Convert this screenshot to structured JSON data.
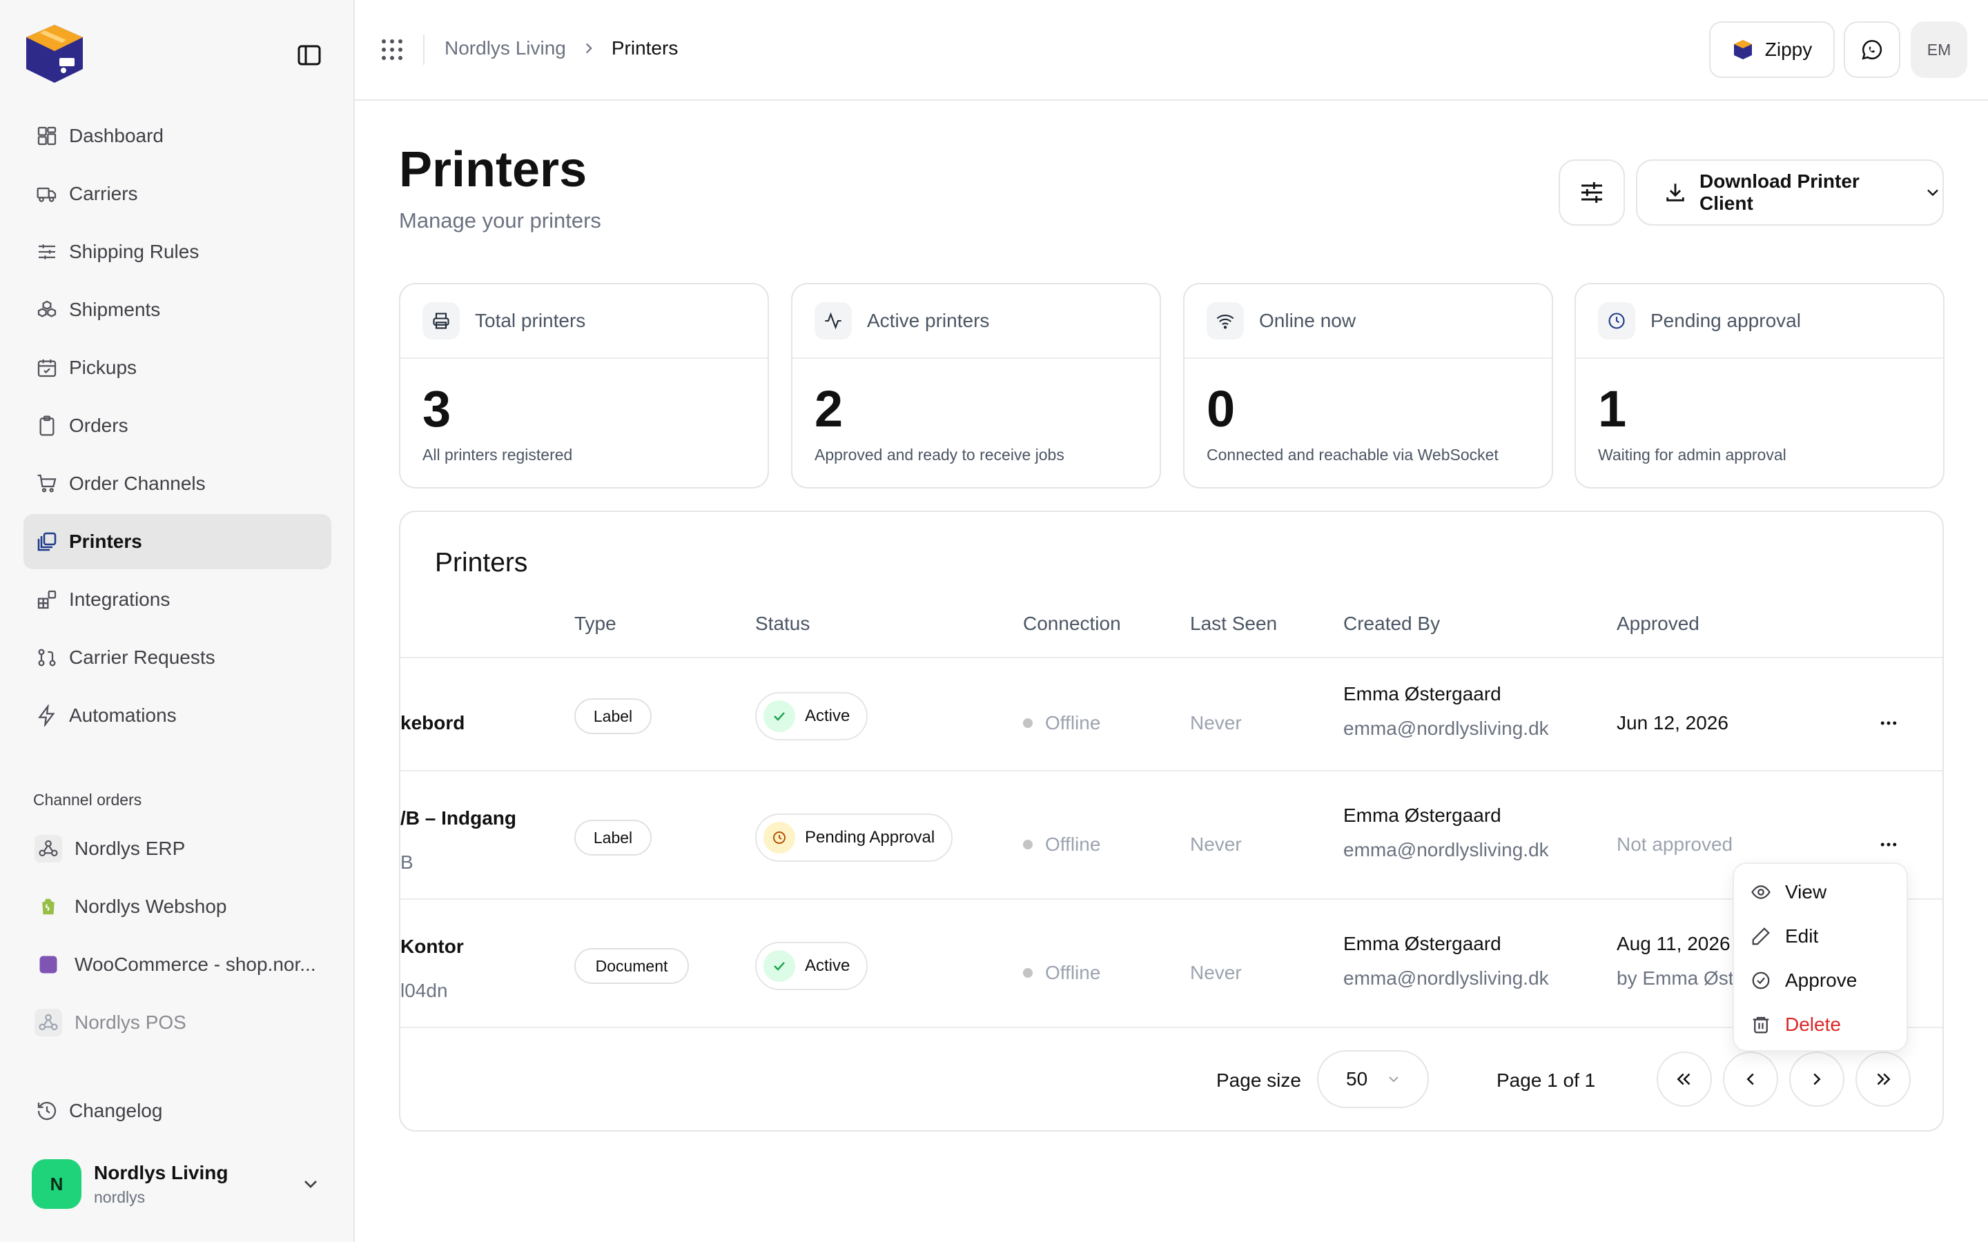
{
  "sidebar": {
    "nav": [
      {
        "label": "Dashboard",
        "icon": "dashboard-icon"
      },
      {
        "label": "Carriers",
        "icon": "truck-icon"
      },
      {
        "label": "Shipping Rules",
        "icon": "sliders-icon"
      },
      {
        "label": "Shipments",
        "icon": "boxes-icon"
      },
      {
        "label": "Pickups",
        "icon": "calendar-check-icon"
      },
      {
        "label": "Orders",
        "icon": "clipboard-icon"
      },
      {
        "label": "Order Channels",
        "icon": "cart-icon"
      },
      {
        "label": "Printers",
        "icon": "printers-icon",
        "active": true
      },
      {
        "label": "Integrations",
        "icon": "blocks-icon"
      },
      {
        "label": "Carrier Requests",
        "icon": "git-pull-request-icon"
      },
      {
        "label": "Automations",
        "icon": "zap-icon"
      }
    ],
    "channels_label": "Channel orders",
    "channels": [
      {
        "label": "Nordlys ERP",
        "icon": "webhook-icon"
      },
      {
        "label": "Nordlys Webshop",
        "icon": "shopify-icon"
      },
      {
        "label": "WooCommerce - shop.nor...",
        "icon": "woocommerce-icon"
      },
      {
        "label": "Nordlys POS",
        "icon": "webhook-icon",
        "muted": true
      }
    ],
    "changelog": "Changelog",
    "user": {
      "initial": "N",
      "name": "Nordlys Living",
      "handle": "nordlys"
    }
  },
  "topbar": {
    "breadcrumb_parent": "Nordlys Living",
    "breadcrumb_current": "Printers",
    "assistant_label": "Zippy",
    "avatar_initials": "EM"
  },
  "header": {
    "title": "Printers",
    "subtitle": "Manage your printers",
    "download_label": "Download Printer Client"
  },
  "stats": [
    {
      "label": "Total printers",
      "value": "3",
      "desc": "All printers registered",
      "icon": "printer-icon"
    },
    {
      "label": "Active printers",
      "value": "2",
      "desc": "Approved and ready to receive jobs",
      "icon": "activity-icon"
    },
    {
      "label": "Online now",
      "value": "0",
      "desc": "Connected and reachable via WebSocket",
      "icon": "wifi-icon"
    },
    {
      "label": "Pending approval",
      "value": "1",
      "desc": "Waiting for admin approval",
      "icon": "clock-icon"
    }
  ],
  "table": {
    "title": "Printers",
    "columns": [
      "Type",
      "Status",
      "Connection",
      "Last Seen",
      "Created By",
      "Approved"
    ],
    "rows": [
      {
        "name": "kebord",
        "sub": "",
        "type": "Label",
        "status": "Active",
        "connection": "Offline",
        "last_seen": "Never",
        "created_name": "Emma Østergaard",
        "created_email": "emma@nordlysliving.dk",
        "approved": "Jun 12, 2026",
        "approved_sub": ""
      },
      {
        "name": "/B – Indgang",
        "sub": "B",
        "type": "Label",
        "status": "Pending Approval",
        "connection": "Offline",
        "last_seen": "Never",
        "created_name": "Emma Østergaard",
        "created_email": "emma@nordlysliving.dk",
        "approved": "Not approved",
        "approved_sub": ""
      },
      {
        "name": "Kontor",
        "sub": "l04dn",
        "type": "Document",
        "status": "Active",
        "connection": "Offline",
        "last_seen": "Never",
        "created_name": "Emma Østergaard",
        "created_email": "emma@nordlysliving.dk",
        "approved": "Aug 11, 2026",
        "approved_sub": "by Emma Øst"
      }
    ],
    "page_size_label": "Page size",
    "page_size_value": "50",
    "page_info": "Page 1 of 1"
  },
  "menu": {
    "items": [
      "View",
      "Edit",
      "Approve",
      "Delete"
    ]
  },
  "colors": {
    "accent": "#1e3a8a",
    "brand_orange": "#f59e0b",
    "active_green": "#16a34a",
    "pending_amber": "#b45309",
    "danger": "#dc2626"
  }
}
